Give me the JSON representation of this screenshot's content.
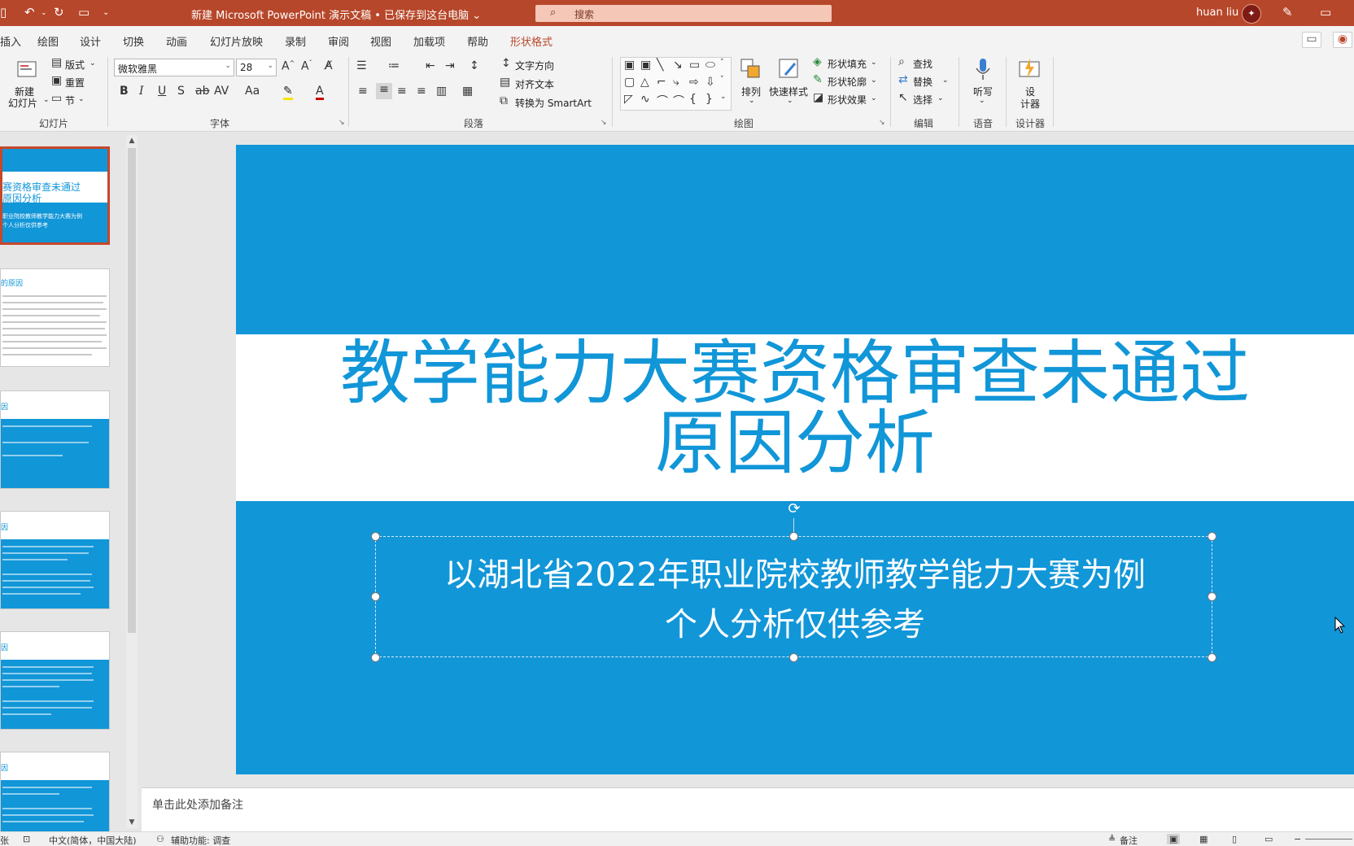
{
  "titlebar": {
    "doc_title": "新建 Microsoft PowerPoint 演示文稿 • 已保存到这台电脑 ⌄",
    "search_placeholder": "搜索",
    "user_name": "huan liu",
    "qa_icons": [
      "save-icon",
      "undo-icon",
      "redo-icon",
      "present-from-start-icon",
      "customize-quick-access-icon"
    ]
  },
  "tabs": [
    "插入",
    "绘图",
    "设计",
    "切换",
    "动画",
    "幻灯片放映",
    "录制",
    "审阅",
    "视图",
    "加载项",
    "帮助",
    "形状格式"
  ],
  "active_tab": "形状格式",
  "ribbon": {
    "slides": {
      "new_slide": "新建",
      "new_slide2": "幻灯片",
      "layout": "版式",
      "reset": "重置",
      "section": "节",
      "label": "幻灯片"
    },
    "font": {
      "font_name": "微软雅黑",
      "font_size": "28",
      "bold": "B",
      "italic": "I",
      "underline": "U",
      "shadow": "S",
      "strike": "ab",
      "label": "字体"
    },
    "paragraph": {
      "text_direction": "文字方向",
      "align_text": "对齐文本",
      "smartart": "转换为 SmartArt",
      "label": "段落"
    },
    "drawing": {
      "arrange": "排列",
      "quick_styles": "快速样式",
      "shape_fill": "形状填充",
      "shape_outline": "形状轮廓",
      "shape_effects": "形状效果",
      "label": "绘图"
    },
    "editing": {
      "find": "查找",
      "replace": "替换",
      "select": "选择",
      "label": "编辑"
    },
    "voice": {
      "dictate": "听写",
      "label": "语音"
    },
    "designer": {
      "design1": "设",
      "design2": "计器",
      "label": "设计器"
    }
  },
  "thumbnails": {
    "slide1": {
      "title_l1": "赛资格审查未通过",
      "title_l2": "原因分析",
      "sub_l1": "职业院校教师教学能力大赛为例",
      "sub_l2": "个人分析仅供参考"
    },
    "slide2_title": "的原因",
    "slide3_title": "因",
    "slide4_title": "因",
    "slide5_title": "因",
    "slide6_title": "因"
  },
  "slide": {
    "title_line1": "教学能力大赛资格审查未通过",
    "title_line2": "原因分析",
    "subtitle_line1": "以湖北省2022年职业院校教师教学能力大赛为例",
    "subtitle_line2": "个人分析仅供参考"
  },
  "notes_placeholder": "单击此处添加备注",
  "statusbar": {
    "left_partial": "张",
    "language": "中文(简体，中国大陆)",
    "accessibility": "辅助功能: 调查",
    "notes": "备注"
  },
  "colors": {
    "accent": "#b7472a",
    "slide_blue": "#1196d8",
    "selection": "#c6482a"
  }
}
